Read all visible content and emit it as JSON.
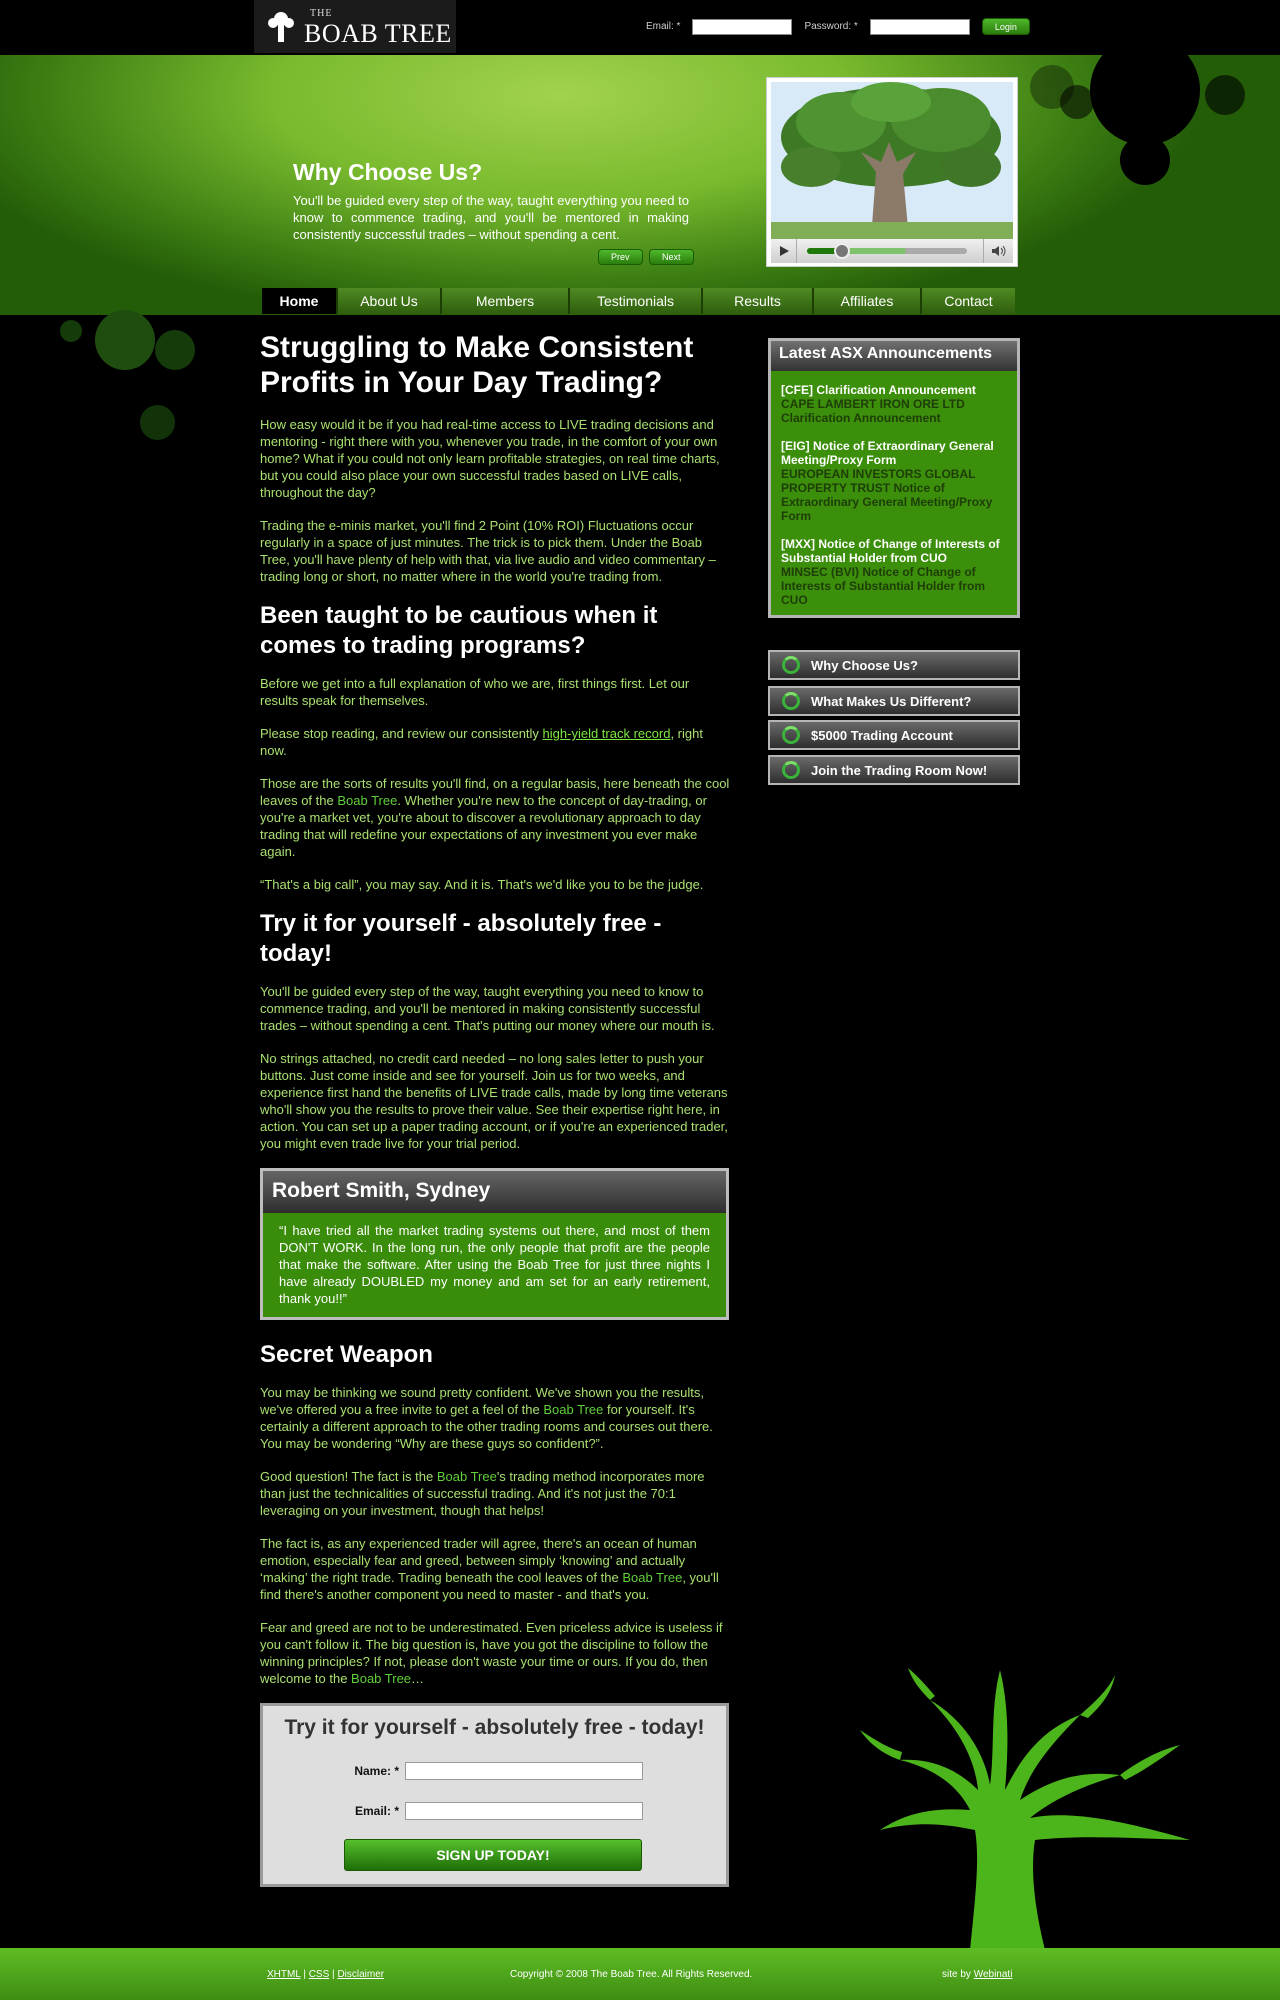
{
  "brand": {
    "small": "THE",
    "name": "BOAB TREE"
  },
  "login": {
    "email_label": "Email: *",
    "password_label": "Password: *",
    "button": "Login"
  },
  "hero": {
    "title": "Why Choose Us?",
    "text": "You'll be guided every step of the way, taught everything you need to know to commence trading, and you'll be mentored in making consistently successful trades – without spending a cent.",
    "prev": "Prev",
    "next": "Next"
  },
  "video": {
    "progress": 0.22,
    "loaded": 0.62
  },
  "nav": [
    "Home",
    "About Us",
    "Members",
    "Testimonials",
    "Results",
    "Affiliates",
    "Contact"
  ],
  "content": {
    "h1": "Struggling to Make Consistent Profits in Your Day Trading?",
    "p1": "How easy would it be if you had real-time access to LIVE trading decisions and mentoring - right there with you, whenever you trade, in the comfort of your own home? What if you could not only learn profitable strategies, on real time charts, but you could also place your own successful trades based on LIVE calls, throughout the day?",
    "p2": "Trading the e-minis market, you'll find 2 Point (10% ROI) Fluctuations occur regularly in a space of just minutes. The trick is to pick them. Under the Boab Tree, you'll have plenty of help with that, via live audio and video commentary – trading long or short, no matter where in the world you're trading from.",
    "h2a": "Been taught to be cautious when it comes to trading programs?",
    "p3": "Before we get into a full explanation of who we are, first things first. Let our results speak for themselves.",
    "p4_pre": "Please stop reading, and review our consistently ",
    "p4_link": "high-yield track record",
    "p4_post": ", right now.",
    "p5_pre": "Those are the sorts of results you'll find, on a regular basis, here beneath the cool leaves of the ",
    "p5_brand": "Boab Tree",
    "p5_post": ". Whether you're new to the concept of day-trading, or you're a market vet, you're about to discover a revolutionary approach to day trading that will redefine your expectations of any investment you ever make again.",
    "p6": "“That's a big call”, you may say. And it is. That's we'd like you to be the judge.",
    "h2b": "Try it for yourself - absolutely free - today!",
    "p7": "You'll be guided every step of the way, taught everything you need to know to commence trading, and you'll be mentored in making consistently successful trades – without spending a cent. That's putting our money where our mouth is.",
    "p8": "No strings attached, no credit card needed – no long sales letter to push your buttons. Just come inside and see for yourself. Join us for two weeks, and experience first hand the benefits of LIVE trade calls, made by long time veterans who'll show you the results to prove their value. See their expertise right here, in action. You can set up a paper trading account, or if you're an experienced trader, you might even trade live for your trial period.",
    "testimonial": {
      "name": "Robert Smith, Sydney",
      "quote": "“I have tried all the market trading systems out there, and most of them DON'T WORK. In the long run, the only people that profit are the people that make the software. After using the Boab Tree for just three nights I have already DOUBLED my money and am set for an early retirement, thank you!!”"
    },
    "h2c": "Secret Weapon",
    "p9_pre": "You may be thinking we sound pretty confident. We've shown you the results, we've offered you a free invite to get a feel of the ",
    "p9_brand": "Boab Tree",
    "p9_post": " for yourself. It's certainly a different approach to the other trading rooms and courses out there. You may be wondering “Why are these guys so confident?”.",
    "p10_pre": "Good question! The fact is the ",
    "p10_brand": "Boab Tree",
    "p10_post": "'s trading method incorporates more than just the technicalities of successful trading. And it's not just the 70:1 leveraging on your investment, though that helps!",
    "p11_pre": "The fact is, as any experienced trader will agree, there's an ocean of human emotion, especially fear and greed, between simply ‘knowing’ and actually ‘making’ the right trade. Trading beneath the cool leaves of the ",
    "p11_brand": "Boab Tree",
    "p11_post": ", you'll find there's another component you need to master - and that's you.",
    "p12_pre": "Fear and greed are not to be underestimated. Even priceless advice is useless if you can't follow it. The big question is, have you got the discipline to follow the winning principles? If not, please don't waste your time or ours. If you do, then welcome to the ",
    "p12_brand": "Boab Tree",
    "p12_post": "…"
  },
  "signup": {
    "title": "Try it for yourself - absolutely free - today!",
    "name_label": "Name: *",
    "email_label": "Email: *",
    "button": "SIGN UP TODAY!"
  },
  "sidebar": {
    "asx_title": "Latest ASX Announcements",
    "announcements": [
      {
        "title": "[CFE] Clarification Announcement",
        "desc": "CAPE LAMBERT IRON ORE LTD Clarification Announcement"
      },
      {
        "title": "[EIG] Notice of Extraordinary General Meeting/Proxy Form",
        "desc": "EUROPEAN INVESTORS GLOBAL PROPERTY TRUST Notice of Extraordinary General Meeting/Proxy Form"
      },
      {
        "title": "[MXX] Notice of Change of Interests of Substantial Holder from CUO",
        "desc": "MINSEC (BVI) Notice of Change of Interests of Substantial Holder from CUO"
      }
    ],
    "buttons": [
      "Why Choose Us?",
      "What Makes Us Different?",
      "$5000 Trading Account",
      "Join the Trading Room Now!"
    ]
  },
  "footer": {
    "xhtml": "XHTML",
    "css": "CSS",
    "disclaimer": "Disclaimer",
    "sep": "|",
    "copyright": "Copyright  © 2008 The Boab Tree. All Rights Reserved.",
    "site_by": "site by ",
    "webinati": "Webinati"
  },
  "colors": {
    "accent_green": "#3b8f0a",
    "text_green": "#a9e070",
    "link_green": "#7ee640",
    "brand_green": "#5fd03a"
  }
}
